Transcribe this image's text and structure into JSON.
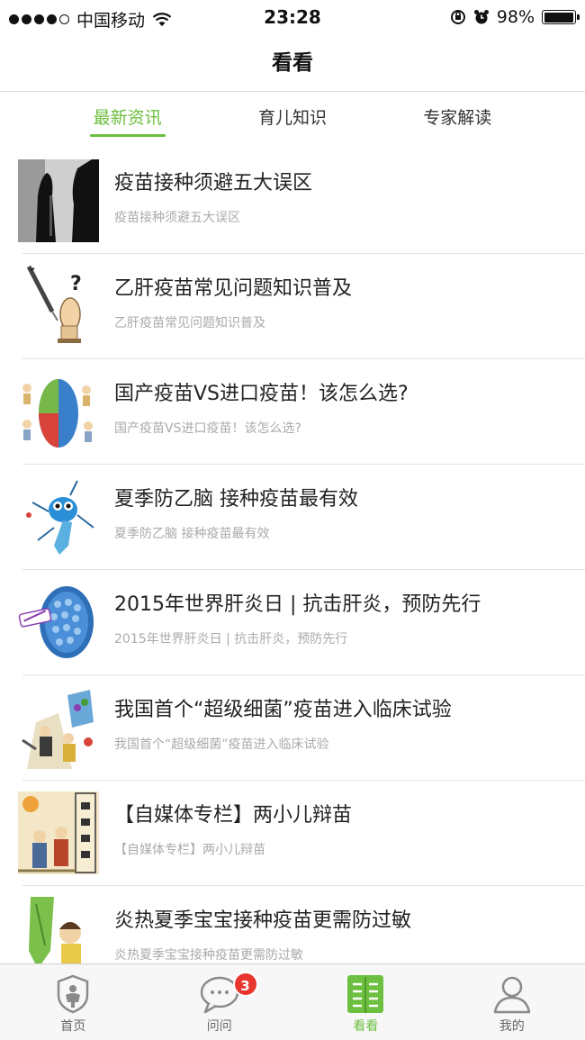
{
  "status_bar": {
    "carrier": "中国移动",
    "time": "23:28",
    "battery": "98%",
    "battery_level": 0.98
  },
  "nav": {
    "title": "看看"
  },
  "tabs": [
    {
      "label": "最新资讯",
      "active": true
    },
    {
      "label": "育儿知识",
      "active": false
    },
    {
      "label": "专家解读",
      "active": false
    }
  ],
  "news": [
    {
      "title": "疫苗接种须避五大误区",
      "subtitle": "疫苗接种须避五大误区"
    },
    {
      "title": "乙肝疫苗常见问题知识普及",
      "subtitle": "乙肝疫苗常见问题知识普及"
    },
    {
      "title": "国产疫苗VS进口疫苗！该怎么选?",
      "subtitle": "国产疫苗VS进口疫苗！该怎么选?"
    },
    {
      "title": "夏季防乙脑 接种疫苗最有效",
      "subtitle": "夏季防乙脑 接种疫苗最有效"
    },
    {
      "title": "2015年世界肝炎日 | 抗击肝炎，预防先行",
      "subtitle": "2015年世界肝炎日 | 抗击肝炎，预防先行"
    },
    {
      "title": "我国首个“超级细菌”疫苗进入临床试验",
      "subtitle": "我国首个“超级细菌”疫苗进入临床试验"
    },
    {
      "title": "【自媒体专栏】两小儿辩苗",
      "subtitle": "【自媒体专栏】两小儿辩苗"
    },
    {
      "title": "炎热夏季宝宝接种疫苗更需防过敏",
      "subtitle": "炎热夏季宝宝接种疫苗更需防过敏"
    }
  ],
  "tab_bar": [
    {
      "label": "首页",
      "icon": "home-shield-icon",
      "active": false
    },
    {
      "label": "问问",
      "icon": "chat-bubble-icon",
      "active": false,
      "badge": "3"
    },
    {
      "label": "看看",
      "icon": "article-list-icon",
      "active": true
    },
    {
      "label": "我的",
      "icon": "user-icon",
      "active": false
    }
  ],
  "colors": {
    "accent": "#6cbf3f",
    "badge": "#e8362e"
  }
}
